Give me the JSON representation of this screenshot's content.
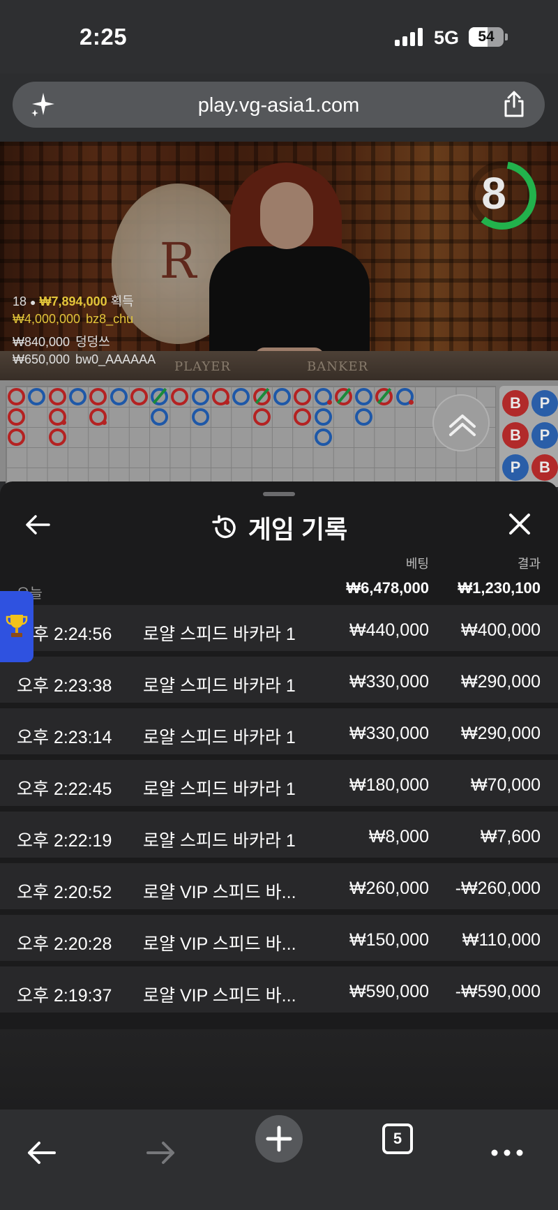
{
  "status_bar": {
    "time": "2:25",
    "network": "5G",
    "battery": "54",
    "battery_level": 0.54
  },
  "browser": {
    "url": "play.vg-asia1.com",
    "tabs_count": "5"
  },
  "video": {
    "timer": "8",
    "table_labels": [
      "PLAYER",
      "BANKER"
    ],
    "emblem_letter": "R",
    "winners_summary": {
      "count": "18",
      "total": "₩7,894,000",
      "suffix": "획득"
    },
    "winners": [
      {
        "amount": "₩4,000,000",
        "name": "bz8_chu"
      },
      {
        "amount": "₩840,000",
        "name": "덩덩쓰"
      },
      {
        "amount": "₩650,000",
        "name": "bw0_AAAAAA"
      }
    ]
  },
  "roadmap": {
    "side_beads": [
      "B",
      "P",
      "B",
      "P",
      "P",
      "B"
    ]
  },
  "history": {
    "title": "게임 기록",
    "col_bet": "베팅",
    "col_result": "결과",
    "date_label": "오늘",
    "total_bet": "₩6,478,000",
    "total_result": "₩1,230,100",
    "rows": [
      {
        "time": "오후 2:24:56",
        "game": "로얄 스피드 바카라 1",
        "bet": "₩440,000",
        "result": "₩400,000"
      },
      {
        "time": "오후 2:23:38",
        "game": "로얄 스피드 바카라 1",
        "bet": "₩330,000",
        "result": "₩290,000"
      },
      {
        "time": "오후 2:23:14",
        "game": "로얄 스피드 바카라 1",
        "bet": "₩330,000",
        "result": "₩290,000"
      },
      {
        "time": "오후 2:22:45",
        "game": "로얄 스피드 바카라 1",
        "bet": "₩180,000",
        "result": "₩70,000"
      },
      {
        "time": "오후 2:22:19",
        "game": "로얄 스피드 바카라 1",
        "bet": "₩8,000",
        "result": "₩7,600"
      },
      {
        "time": "오후 2:20:52",
        "game": "로얄 VIP 스피드 바...",
        "bet": "₩260,000",
        "result": "-₩260,000"
      },
      {
        "time": "오후 2:20:28",
        "game": "로얄 VIP 스피드 바...",
        "bet": "₩150,000",
        "result": "₩110,000"
      },
      {
        "time": "오후 2:19:37",
        "game": "로얄 VIP 스피드 바...",
        "bet": "₩590,000",
        "result": "-₩590,000"
      }
    ]
  },
  "icons": {
    "sparkle": "sparkle-icon",
    "share": "share-icon",
    "back": "arrow-left-icon",
    "history": "history-icon",
    "close": "close-icon",
    "trophy": "trophy-icon",
    "forward": "arrow-right-icon",
    "plus": "plus-icon",
    "tabs": "tabs-icon",
    "more": "more-icon",
    "collapse": "chevrons-up-icon"
  },
  "colors": {
    "timer": "#22b24c",
    "gold": "#e3c53a",
    "banker": "#b42222",
    "player": "#1e58a8",
    "tie": "#1a8a3a",
    "trophy_tab": "#2f52e0"
  }
}
